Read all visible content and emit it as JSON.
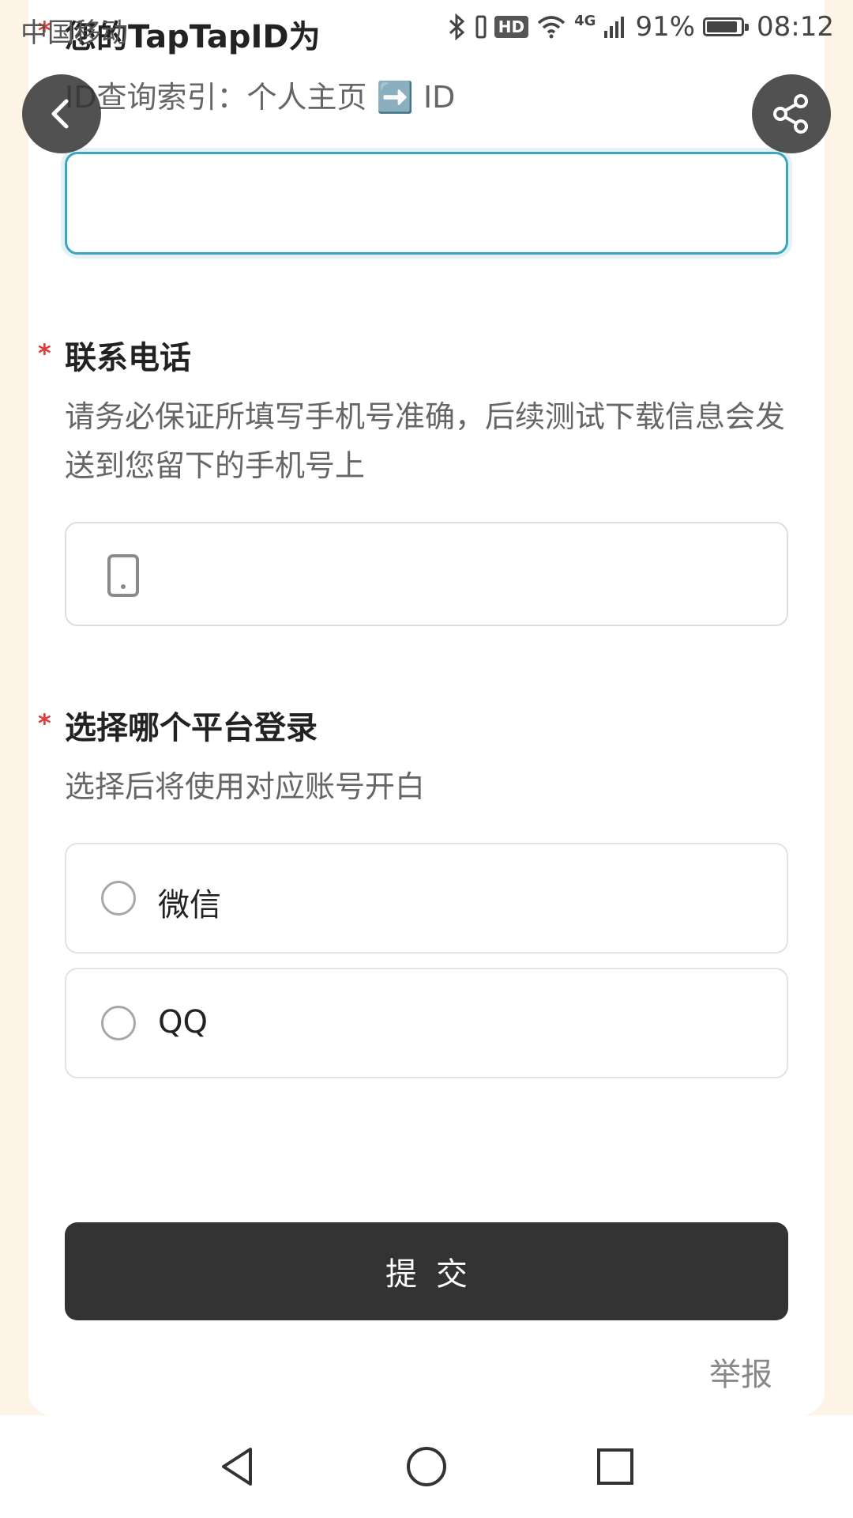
{
  "status_bar": {
    "carrier": "中国移动",
    "battery_percent": "91%",
    "time": "08:12",
    "network": "4G",
    "hd_label": "HD",
    "battery_level": 0.91
  },
  "section_id": {
    "title": "您的TapTapID为",
    "hint": "ID查询索引：个人主页 ➡️ ID",
    "input_value": ""
  },
  "section_phone": {
    "title": "联系电话",
    "description": "请务必保证所填写手机号准确，后续测试下载信息会发送到您留下的手机号上",
    "input_value": ""
  },
  "section_platform": {
    "title": "选择哪个平台登录",
    "description": "选择后将使用对应账号开白",
    "options": [
      {
        "label": "微信"
      },
      {
        "label": "QQ"
      }
    ]
  },
  "required_mark": "*",
  "submit_label": "提交",
  "report_label": "举报",
  "icons": {
    "back": "chevron-left-icon",
    "share": "share-icon",
    "phone": "mobile-phone-icon",
    "nav_back": "triangle-back-icon",
    "nav_home": "circle-home-icon",
    "nav_recent": "square-recent-icon"
  }
}
